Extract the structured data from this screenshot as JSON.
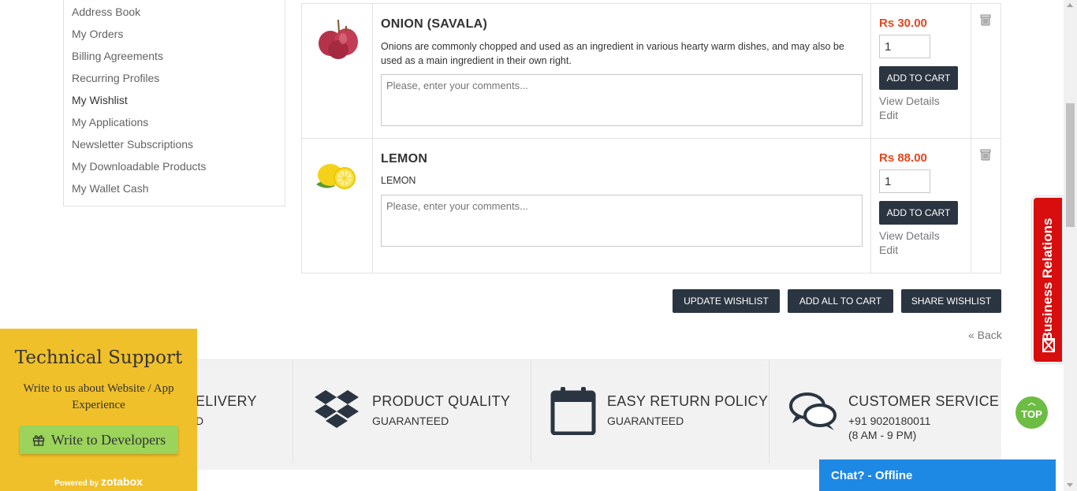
{
  "sidebar": {
    "items": [
      {
        "label": "Address Book"
      },
      {
        "label": "My Orders"
      },
      {
        "label": "Billing Agreements"
      },
      {
        "label": "Recurring Profiles"
      },
      {
        "label": "My Wishlist"
      },
      {
        "label": "My Applications"
      },
      {
        "label": "Newsletter Subscriptions"
      },
      {
        "label": "My Downloadable Products"
      },
      {
        "label": "My Wallet Cash"
      }
    ],
    "active": "My Wishlist"
  },
  "wishlist": {
    "items": [
      {
        "name": "ONION (SAVALA)",
        "description": "Onions are commonly chopped and used as an ingredient in various hearty warm dishes, and may also be used as a main ingredient in their own right.",
        "comment_placeholder": "Please, enter your comments...",
        "price": "Rs 30.00",
        "qty": "1",
        "add_to_cart": "ADD TO CART",
        "view_details": "View Details",
        "edit": "Edit"
      },
      {
        "name": "LEMON",
        "description": "LEMON",
        "comment_placeholder": "Please, enter your comments...",
        "price": "Rs 88.00",
        "qty": "1",
        "add_to_cart": "ADD TO CART",
        "view_details": "View Details",
        "edit": "Edit"
      }
    ],
    "actions": {
      "update": "UPDATE WISHLIST",
      "add_all": "ADD ALL TO CART",
      "share": "SHARE WISHLIST"
    },
    "back": "« Back"
  },
  "features": [
    {
      "title": "ELIVERY",
      "sub": "D",
      "icon": "truck-icon"
    },
    {
      "title": "PRODUCT QUALITY",
      "sub": "GUARANTEED",
      "icon": "dropbox-icon"
    },
    {
      "title": "EASY RETURN POLICY",
      "sub": "GUARANTEED",
      "icon": "calendar-icon"
    },
    {
      "title": "CUSTOMER SERVICE",
      "sub": "+91 9020180011",
      "sub2": "(8 AM - 9 PM)",
      "icon": "chat-bubbles-icon"
    }
  ],
  "support": {
    "title": "Technical Support",
    "text": "Write to us about Website / App Experience",
    "button": "Write to Developers",
    "powered_by": "Powered by",
    "brand": "zotabox",
    "color": "#f0c02a"
  },
  "business_relations": {
    "label": "Business Relations",
    "color": "#d80e0e"
  },
  "top_button": {
    "label": "TOP",
    "color": "#6dbd45"
  },
  "chat": {
    "label": "Chat? - Offline",
    "color": "#1e88e5"
  },
  "colors": {
    "price": "#e5461e",
    "button": "#2b3542"
  }
}
